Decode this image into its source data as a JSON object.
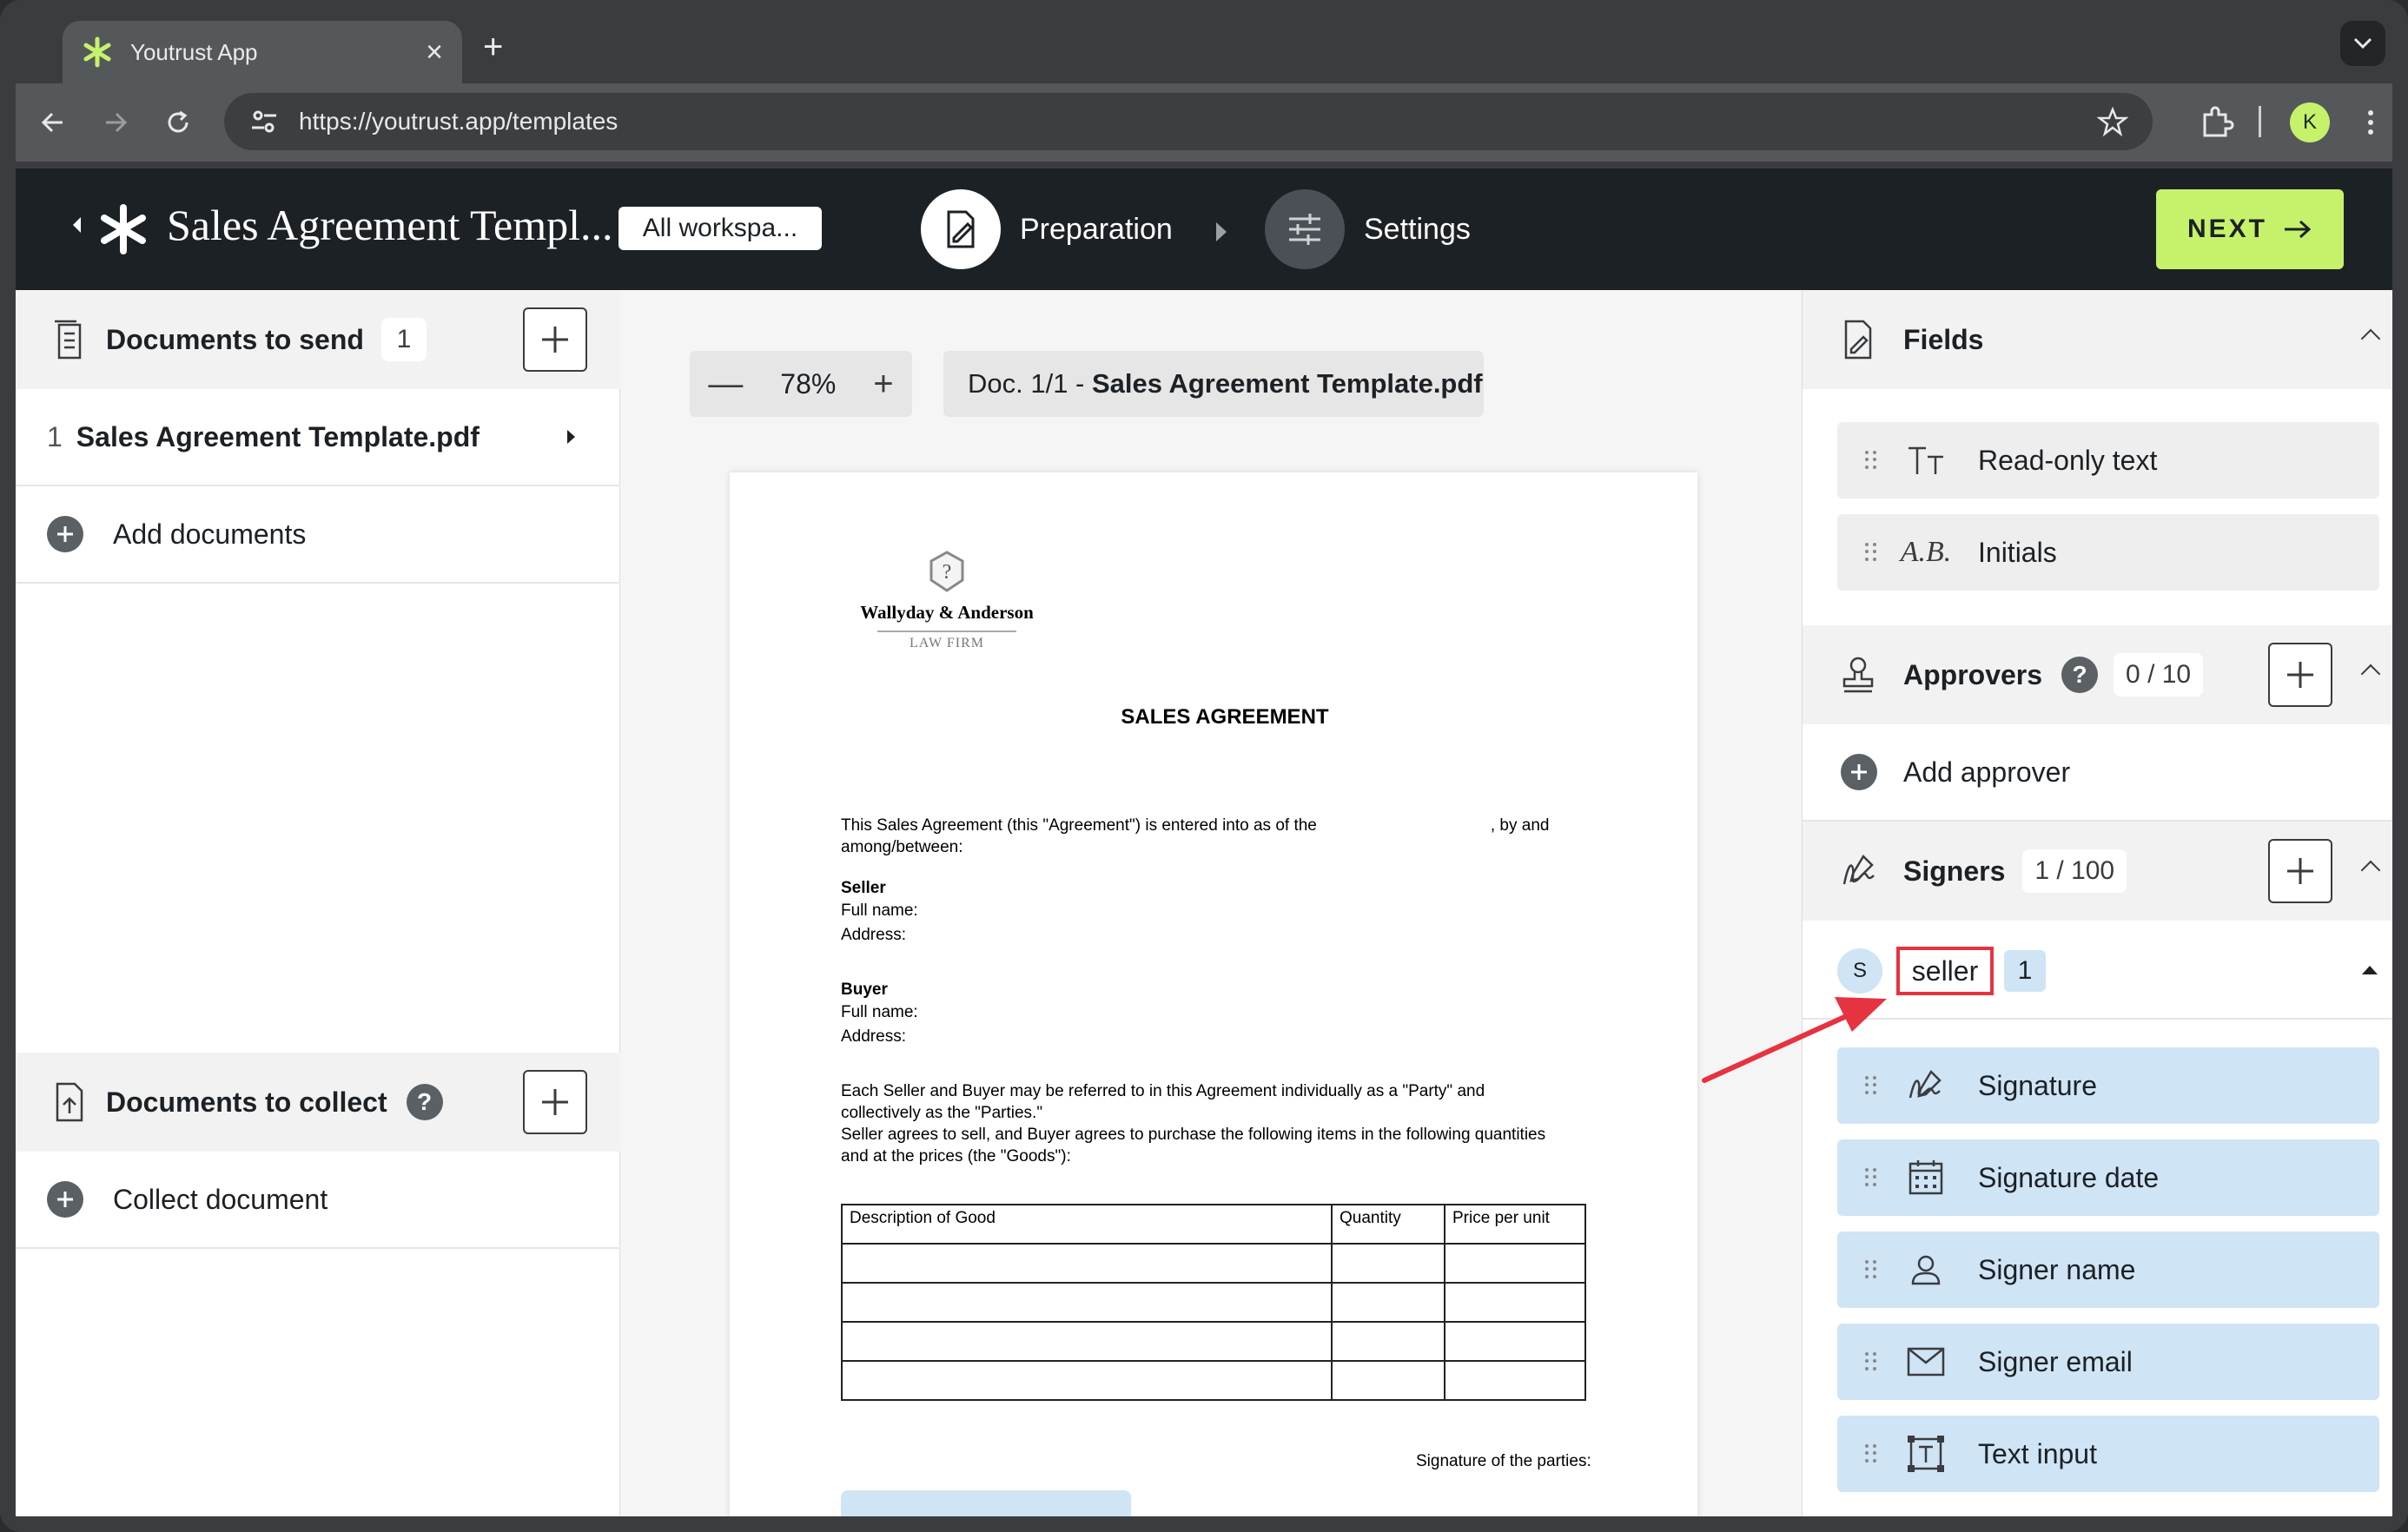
{
  "browser": {
    "tab_title": "Youtrust App",
    "url": "https://youtrust.app/templates",
    "profile_initial": "K"
  },
  "header": {
    "doc_title": "Sales Agreement Templ...",
    "workspace": "All workspa...",
    "steps": [
      {
        "label": "Preparation",
        "active": true
      },
      {
        "label": "Settings",
        "active": false
      }
    ],
    "next_label": "NEXT"
  },
  "left": {
    "send_title": "Documents to send",
    "send_count": "1",
    "documents": [
      {
        "index": "1",
        "name": "Sales Agreement Template.pdf"
      }
    ],
    "add_documents": "Add documents",
    "collect_title": "Documents to collect",
    "collect_doc": "Collect document"
  },
  "viewer": {
    "zoom": "78%",
    "doc_prefix": "Doc. 1/1 - ",
    "doc_name": "Sales Agreement Template.pdf"
  },
  "document": {
    "firm_name": "Wallyday & Anderson",
    "firm_sub": "LAW FIRM",
    "title": "SALES AGREEMENT",
    "intro_1": "This Sales Agreement (this \"Agreement\") is entered into as of the",
    "intro_1b": ", by and",
    "intro_2": "among/between:",
    "seller_heading": "Seller",
    "seller_name": "Full name:",
    "seller_address": "Address:",
    "buyer_heading": "Buyer",
    "buyer_name": "Full name:",
    "buyer_address": "Address:",
    "party_1": "Each Seller and Buyer may be referred to in this Agreement individually as a \"Party\" and",
    "party_2": "collectively as the \"Parties.\"",
    "goods_1": "Seller agrees to sell, and Buyer agrees to purchase the following items in the following quantities",
    "goods_2": "and at the prices (the \"Goods\"):",
    "table_headers": [
      "Description of Good",
      "Quantity",
      "Price per unit"
    ],
    "signature_label": "Signature of the parties:"
  },
  "right": {
    "fields_title": "Fields",
    "fields": [
      {
        "label": "Read-only text",
        "icon": "text-type-icon"
      },
      {
        "label": "Initials",
        "icon": "initials-icon"
      }
    ],
    "approvers_title": "Approvers",
    "approvers_count": "0 / 10",
    "add_approver": "Add approver",
    "signers_title": "Signers",
    "signers_count": "1 / 100",
    "signer": {
      "initial": "S",
      "name": "seller",
      "count": "1"
    },
    "signer_fields": [
      {
        "label": "Signature",
        "icon": "signature-icon"
      },
      {
        "label": "Signature date",
        "icon": "calendar-icon"
      },
      {
        "label": "Signer name",
        "icon": "person-icon"
      },
      {
        "label": "Signer email",
        "icon": "envelope-icon"
      },
      {
        "label": "Text input",
        "icon": "text-input-icon"
      }
    ]
  },
  "colors": {
    "accent": "#c6f26b",
    "header_bg": "#1c2125",
    "field_blue": "#cfe4f5",
    "annotation_red": "#e5333f"
  }
}
